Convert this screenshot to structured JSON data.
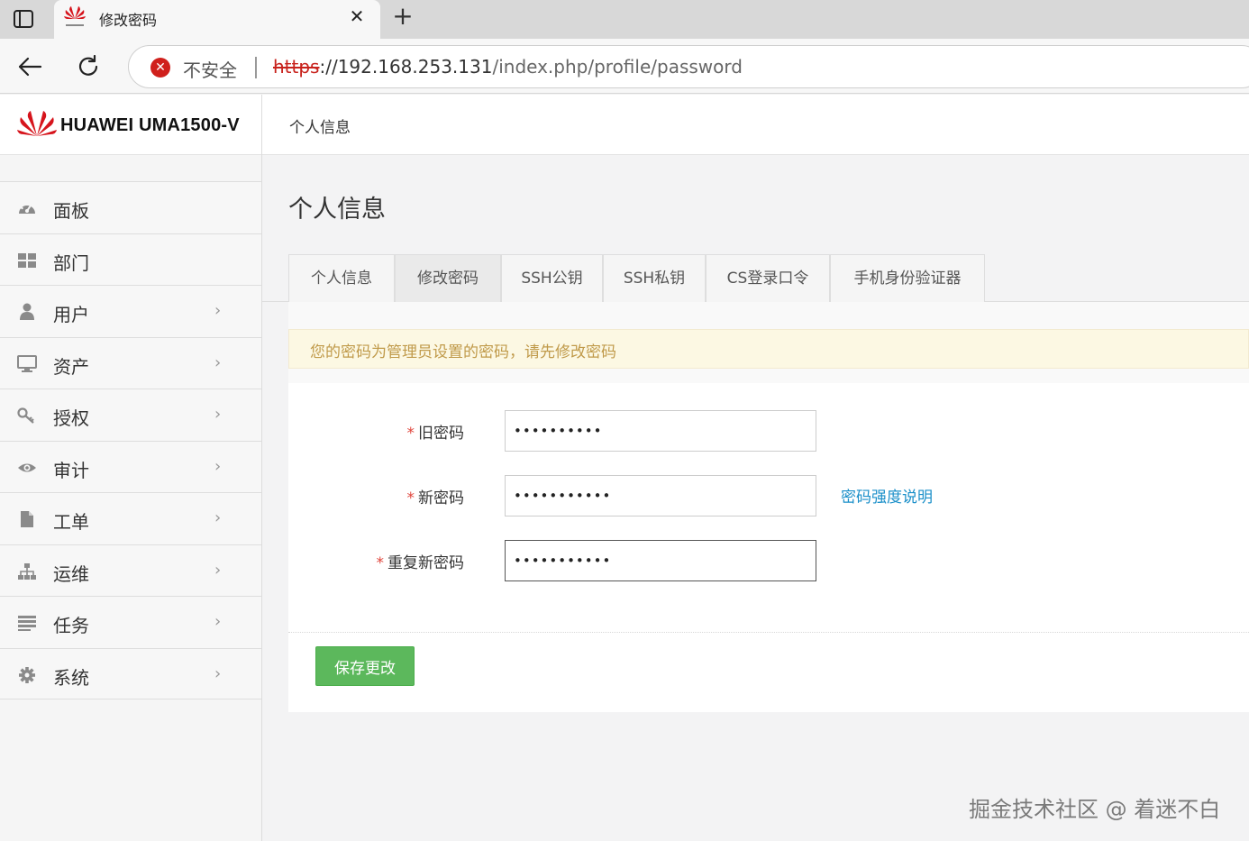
{
  "browser": {
    "tab_title": "修改密码",
    "tab_close": "✕",
    "new_tab": "+",
    "security_text": "不安全",
    "url_protocol": "https",
    "url_host": "://192.168.253.131",
    "url_path": "/index.php/profile/password"
  },
  "app": {
    "logo_text": "HUAWEI UMA1500-V"
  },
  "sidebar": {
    "items": [
      {
        "label": "面板",
        "icon": "dashboard-icon",
        "chevron": ""
      },
      {
        "label": "部门",
        "icon": "grid-icon",
        "chevron": ""
      },
      {
        "label": "用户",
        "icon": "user-icon",
        "chevron": "›"
      },
      {
        "label": "资产",
        "icon": "monitor-icon",
        "chevron": "›"
      },
      {
        "label": "授权",
        "icon": "key-icon",
        "chevron": "›"
      },
      {
        "label": "审计",
        "icon": "eye-icon",
        "chevron": "›"
      },
      {
        "label": "工单",
        "icon": "file-icon",
        "chevron": "›"
      },
      {
        "label": "运维",
        "icon": "sitemap-icon",
        "chevron": "›"
      },
      {
        "label": "任务",
        "icon": "list-icon",
        "chevron": "›"
      },
      {
        "label": "系统",
        "icon": "gear-icon",
        "chevron": "›"
      }
    ]
  },
  "header": {
    "breadcrumb": "个人信息"
  },
  "main": {
    "title": "个人信息",
    "tabs": [
      {
        "label": "个人信息",
        "active": false
      },
      {
        "label": "修改密码",
        "active": true
      },
      {
        "label": "SSH公钥",
        "active": false
      },
      {
        "label": "SSH私钥",
        "active": false
      },
      {
        "label": "CS登录口令",
        "active": false
      },
      {
        "label": "手机身份验证器",
        "active": false
      }
    ],
    "alert": "您的密码为管理员设置的密码，请先修改密码",
    "form": {
      "required_mark": "*",
      "old_password_label": "旧密码",
      "old_password_value": "••••••••••",
      "new_password_label": "新密码",
      "new_password_value": "•••••••••••",
      "repeat_password_label": "重复新密码",
      "repeat_password_value": "•••••••••••",
      "strength_link": "密码强度说明",
      "save_label": "保存更改"
    }
  },
  "watermark": "掘金技术社区 @ 着迷不白"
}
